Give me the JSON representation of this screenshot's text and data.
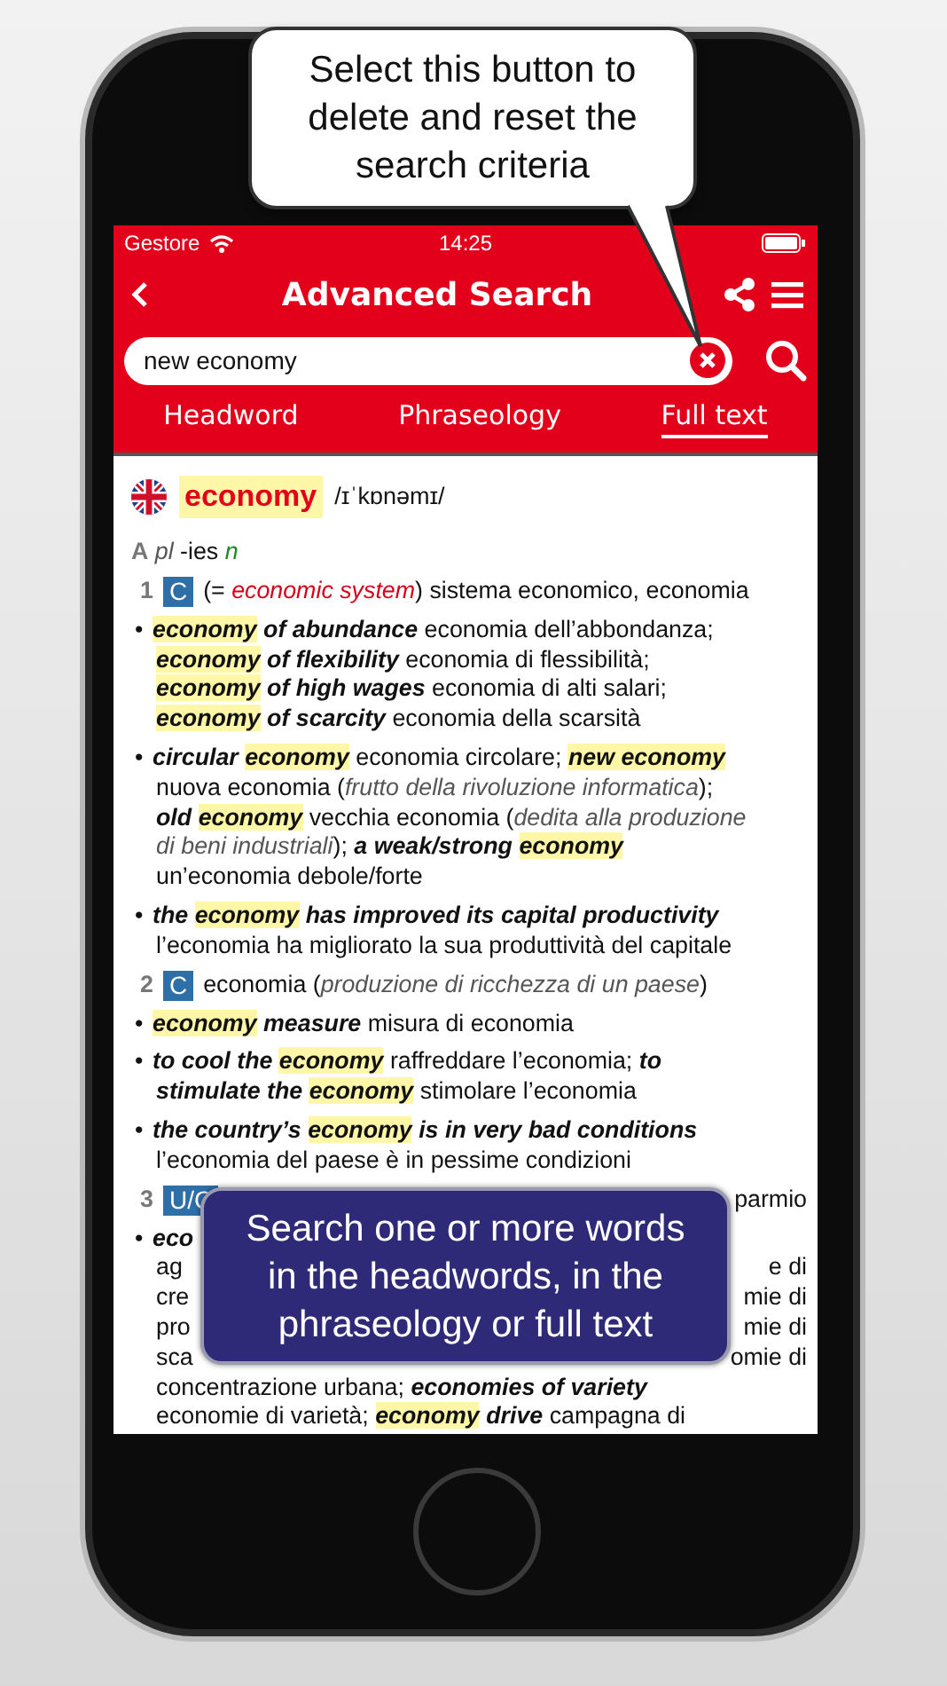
{
  "callouts": [
    {
      "kind": "bubble",
      "text": "Select this button to delete and reset the search criteria"
    },
    {
      "kind": "banner",
      "text": "Search one or more words in the headwords, in the phraseology or full text"
    }
  ],
  "status_bar": {
    "carrier": "Gestore",
    "time": "14:25"
  },
  "nav": {
    "title": "Advanced Search"
  },
  "search": {
    "value": "new economy"
  },
  "tabs": [
    {
      "label": "Headword",
      "selected": false
    },
    {
      "label": "Phraseology",
      "selected": false
    },
    {
      "label": "Full text",
      "selected": true
    }
  ],
  "entry": {
    "headword": "economy",
    "pronunciation": "/ɪˈkɒnəmɪ/",
    "blocks": [
      {
        "kind": "pos",
        "segs": [
          {
            "kind": "label",
            "text": "A"
          },
          {
            "kind": "italic",
            "text": " pl"
          },
          {
            "kind": "plain",
            "text": " -ies "
          },
          {
            "kind": "green",
            "text": "n"
          }
        ]
      },
      {
        "kind": "sense",
        "number": "1",
        "badge": "C",
        "segs": [
          {
            "kind": "plain",
            "text": "(= "
          },
          {
            "kind": "red",
            "text": "economic system"
          },
          {
            "kind": "plain",
            "text": ") sistema economico, economia"
          }
        ]
      },
      {
        "kind": "bullet",
        "bullet": "•",
        "lines": [
          {
            "segs": [
              {
                "kind": "mark",
                "text": "economy"
              },
              {
                "kind": "bold",
                "text": " of abundance"
              },
              {
                "kind": "plain",
                "text": " economia dell’abbondanza;"
              }
            ]
          },
          {
            "segs": [
              {
                "kind": "mark",
                "text": "economy"
              },
              {
                "kind": "bold",
                "text": " of flexibility"
              },
              {
                "kind": "plain",
                "text": " economia di flessibilità;"
              }
            ]
          },
          {
            "segs": [
              {
                "kind": "mark",
                "text": "economy"
              },
              {
                "kind": "bold",
                "text": " of high wages"
              },
              {
                "kind": "plain",
                "text": " economia di alti salari;"
              }
            ]
          },
          {
            "segs": [
              {
                "kind": "mark",
                "text": "economy"
              },
              {
                "kind": "bold",
                "text": " of scarcity"
              },
              {
                "kind": "plain",
                "text": " economia della scarsità"
              }
            ]
          }
        ]
      },
      {
        "kind": "bullet",
        "bullet": "•",
        "lines": [
          {
            "segs": [
              {
                "kind": "bold",
                "text": "circular "
              },
              {
                "kind": "mark",
                "text": "economy"
              },
              {
                "kind": "plain",
                "text": " economia circolare; "
              },
              {
                "kind": "mark",
                "text": "new economy"
              }
            ]
          },
          {
            "segs": [
              {
                "kind": "plain",
                "text": "nuova economia ("
              },
              {
                "kind": "italic",
                "text": "frutto della rivoluzione informatica"
              },
              {
                "kind": "plain",
                "text": ");"
              }
            ]
          },
          {
            "segs": [
              {
                "kind": "bold",
                "text": "old "
              },
              {
                "kind": "mark",
                "text": "economy"
              },
              {
                "kind": "plain",
                "text": " vecchia economia ("
              },
              {
                "kind": "italic",
                "text": "dedita alla produzione"
              }
            ]
          },
          {
            "segs": [
              {
                "kind": "italic",
                "text": "di beni industriali"
              },
              {
                "kind": "plain",
                "text": "); "
              },
              {
                "kind": "bold",
                "text": "a weak/strong "
              },
              {
                "kind": "mark",
                "text": "economy"
              }
            ]
          },
          {
            "segs": [
              {
                "kind": "plain",
                "text": "un’economia debole/forte"
              }
            ]
          }
        ]
      },
      {
        "kind": "bullet",
        "bullet": "•",
        "lines": [
          {
            "segs": [
              {
                "kind": "bold",
                "text": "the "
              },
              {
                "kind": "mark",
                "text": "economy"
              },
              {
                "kind": "bold",
                "text": " has improved its capital productivity"
              }
            ]
          },
          {
            "segs": [
              {
                "kind": "plain",
                "text": "l’economia ha migliorato la sua produttività del capitale"
              }
            ]
          }
        ]
      },
      {
        "kind": "sense",
        "number": "2",
        "badge": "C",
        "segs": [
          {
            "kind": "plain",
            "text": "economia ("
          },
          {
            "kind": "italic",
            "text": "produzione di ricchezza di un paese"
          },
          {
            "kind": "plain",
            "text": ")"
          }
        ]
      },
      {
        "kind": "bullet",
        "bullet": "•",
        "lines": [
          {
            "segs": [
              {
                "kind": "mark",
                "text": "economy"
              },
              {
                "kind": "bold",
                "text": " measure"
              },
              {
                "kind": "plain",
                "text": " misura di economia"
              }
            ]
          }
        ]
      },
      {
        "kind": "bullet",
        "bullet": "•",
        "lines": [
          {
            "segs": [
              {
                "kind": "bold",
                "text": "to cool the "
              },
              {
                "kind": "mark",
                "text": "economy"
              },
              {
                "kind": "plain",
                "text": " raffreddare l’economia; "
              },
              {
                "kind": "bold",
                "text": "to"
              }
            ]
          },
          {
            "segs": [
              {
                "kind": "bold",
                "text": "stimulate the "
              },
              {
                "kind": "mark",
                "text": "economy"
              },
              {
                "kind": "plain",
                "text": " stimolare l’economia"
              }
            ]
          }
        ]
      },
      {
        "kind": "bullet",
        "bullet": "•",
        "lines": [
          {
            "segs": [
              {
                "kind": "bold",
                "text": "the country’s "
              },
              {
                "kind": "mark",
                "text": "economy"
              },
              {
                "kind": "bold",
                "text": " is in very bad conditions"
              }
            ]
          },
          {
            "segs": [
              {
                "kind": "plain",
                "text": "l’economia del paese è in pessime condizioni"
              }
            ]
          }
        ]
      },
      {
        "kind": "sense",
        "number": "3",
        "badge": "U/C",
        "tail": [
          {
            "kind": "plain",
            "text": "parmio"
          }
        ]
      },
      {
        "kind": "bullet",
        "bullet": "•",
        "lines": [
          {
            "segs": [
              {
                "kind": "bold",
                "text": "eco"
              }
            ]
          },
          {
            "segs": [
              {
                "kind": "plain",
                "text": "ag"
              }
            ],
            "tail": [
              {
                "kind": "plain",
                "text": "e di"
              }
            ]
          },
          {
            "segs": [
              {
                "kind": "plain",
                "text": "cre"
              }
            ],
            "tail": [
              {
                "kind": "plain",
                "text": "mie di"
              }
            ]
          },
          {
            "segs": [
              {
                "kind": "plain",
                "text": "pro"
              }
            ],
            "tail": [
              {
                "kind": "plain",
                "text": "mie di"
              }
            ]
          },
          {
            "segs": [
              {
                "kind": "plain",
                "text": "sca"
              }
            ],
            "tail": [
              {
                "kind": "plain",
                "text": "omie di"
              }
            ]
          },
          {
            "segs": [
              {
                "kind": "plain",
                "text": "concentrazione urbana; "
              },
              {
                "kind": "bold",
                "text": "economies of variety"
              }
            ]
          },
          {
            "segs": [
              {
                "kind": "plain",
                "text": "economie di varietà; "
              },
              {
                "kind": "mark",
                "text": "economy"
              },
              {
                "kind": "bold",
                "text": " drive"
              },
              {
                "kind": "plain",
                "text": " campagna di"
              }
            ]
          }
        ]
      }
    ]
  }
}
